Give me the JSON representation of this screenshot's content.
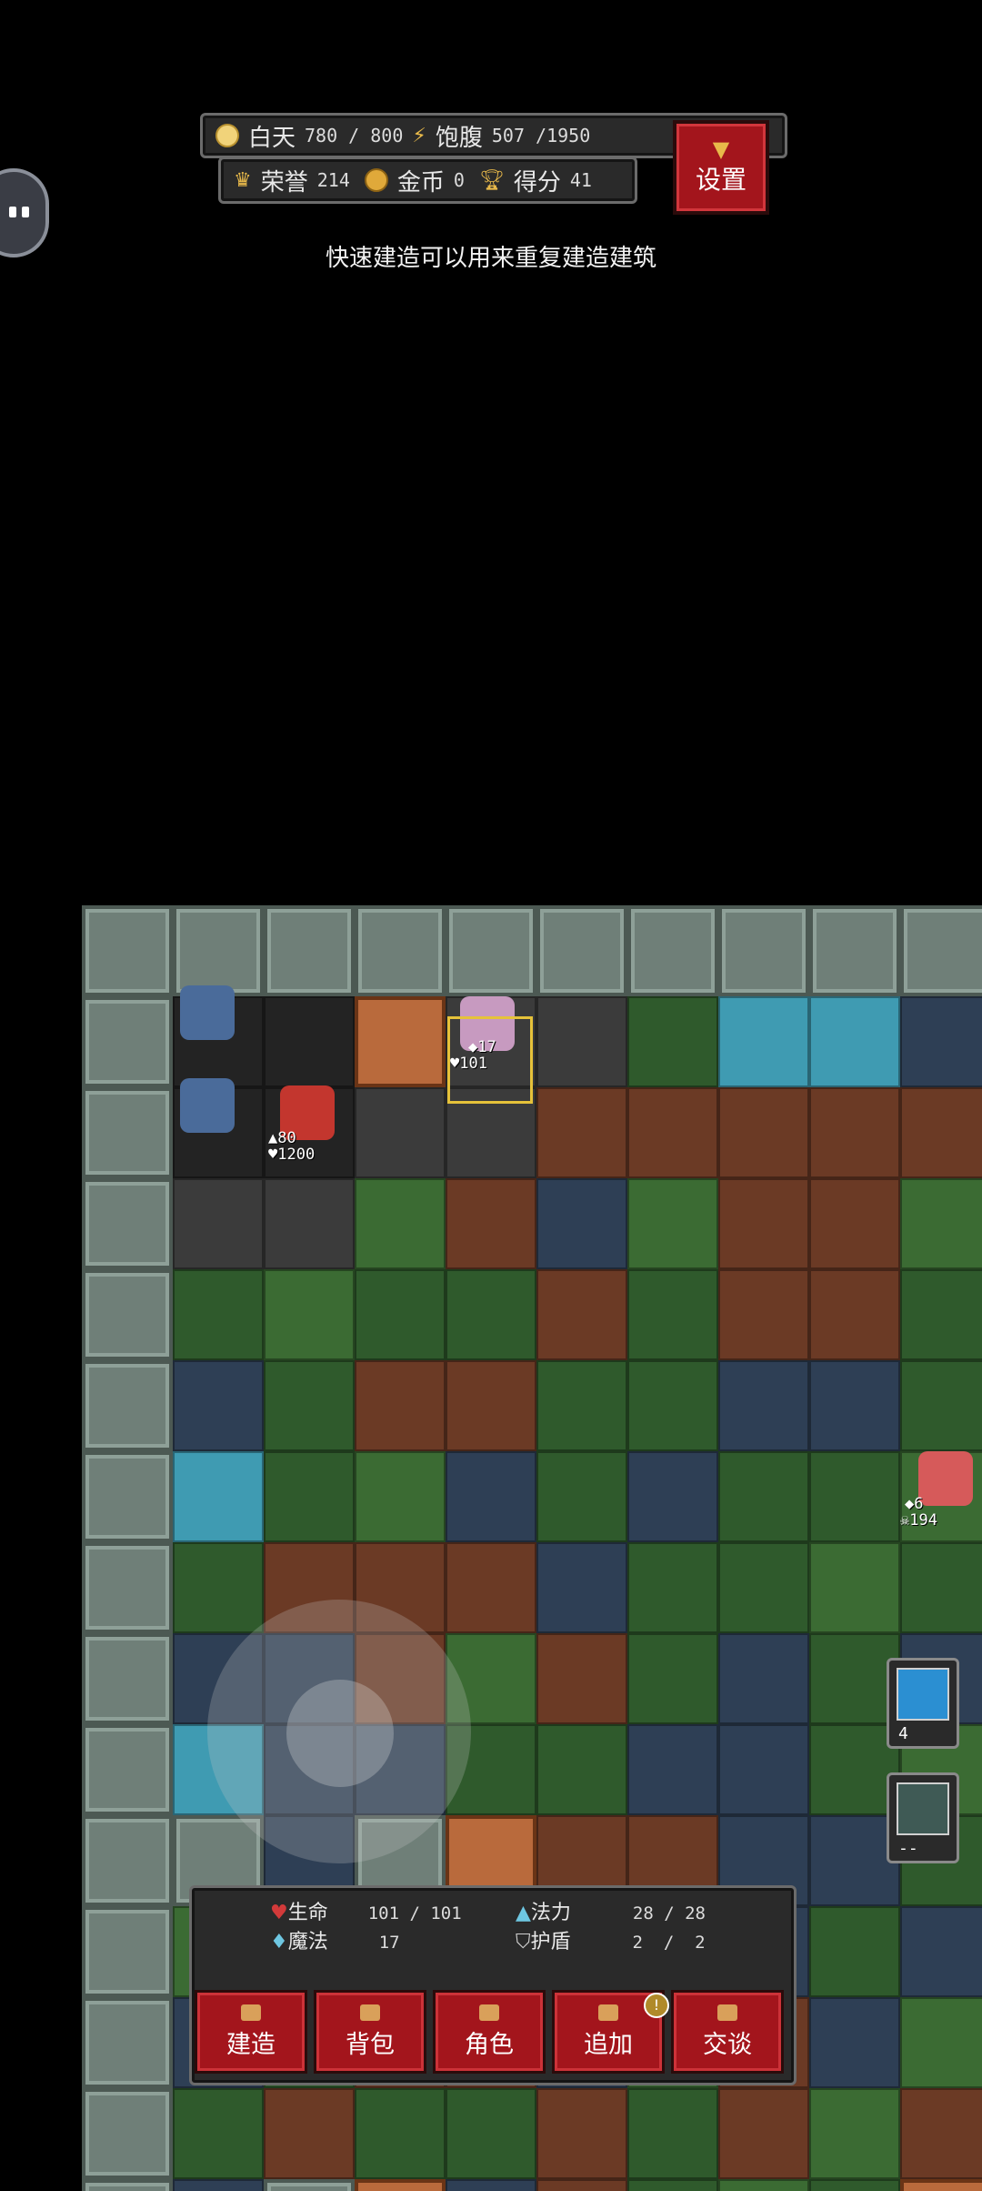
{
  "hud": {
    "daytime_label": "白天",
    "daytime_value": "780 / 800",
    "satiety_label": "饱腹",
    "satiety_value": "507 /1950",
    "honor_label": "荣誉",
    "honor_value": "214",
    "gold_label": "金币",
    "gold_value": "0",
    "score_label": "得分",
    "score_value": "41",
    "settings_label": "设置"
  },
  "hint": "快速建造可以用来重复建造建筑",
  "map": {
    "player": {
      "mp": "17",
      "hp": "101"
    },
    "ally": {
      "attack": "80",
      "hp": "1200"
    },
    "enemy": {
      "attack": "6",
      "hp": "194"
    }
  },
  "skills": [
    {
      "icon": "lightning-skill-icon",
      "count": "4"
    },
    {
      "icon": "shield-skill-icon",
      "count": "--"
    }
  ],
  "status": {
    "life_label": "生命",
    "life_value": "101 / 101",
    "mana_label": "法力",
    "mana_value": "28 / 28",
    "magic_label": "魔法",
    "magic_value": "17",
    "shield_label": "护盾",
    "shield_value": "2  /  2"
  },
  "actions": [
    {
      "label": "建造"
    },
    {
      "label": "背包"
    },
    {
      "label": "角色"
    },
    {
      "label": "追加"
    },
    {
      "label": "交谈"
    }
  ],
  "badge": "!"
}
